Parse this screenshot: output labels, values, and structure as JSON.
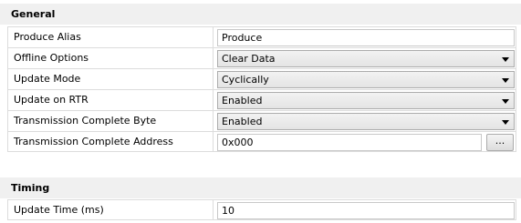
{
  "sections": {
    "general": {
      "title": "General",
      "produce_alias": {
        "label": "Produce Alias",
        "value": "Produce"
      },
      "offline_options": {
        "label": "Offline Options",
        "value": "Clear Data"
      },
      "update_mode": {
        "label": "Update Mode",
        "value": "Cyclically"
      },
      "update_on_rtr": {
        "label": "Update on RTR",
        "value": "Enabled"
      },
      "transmission_complete_byte": {
        "label": "Transmission Complete Byte",
        "value": "Enabled"
      },
      "transmission_complete_address": {
        "label": "Transmission Complete Address",
        "value": "0x000",
        "browse_label": "..."
      }
    },
    "timing": {
      "title": "Timing",
      "update_time": {
        "label": "Update Time (ms)",
        "value": "10"
      }
    }
  },
  "icons": {
    "dropdown_arrow": "chevron-down-icon"
  }
}
